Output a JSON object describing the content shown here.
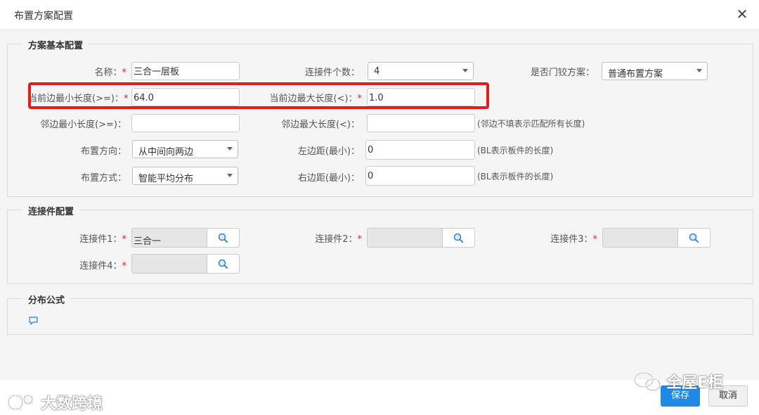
{
  "dialog": {
    "title": "布置方案配置",
    "close_glyph": "✕"
  },
  "basic": {
    "legend": "方案基本配置",
    "name": {
      "label": "名称：",
      "req": "*",
      "value": "三合一层板"
    },
    "connector_count": {
      "label": "连接件个数：",
      "value": "4"
    },
    "door_hinge": {
      "label": "是否门铰方案：",
      "value": "普通布置方案"
    },
    "cur_min": {
      "label": "当前边最小长度(>=)：",
      "req": "*",
      "value": "64.0"
    },
    "cur_max": {
      "label": "当前边最大长度(<)：",
      "req": "*",
      "value": "1.0"
    },
    "adj_min": {
      "label": "邻边最小长度(>=)：",
      "value": ""
    },
    "adj_max": {
      "label": "邻边最大长度(<)：",
      "value": "",
      "hint": "(邻边不填表示匹配所有长度)"
    },
    "direction": {
      "label": "布置方向：",
      "value": "从中间向两边"
    },
    "left_margin": {
      "label": "左边距(最小)：",
      "value": "0",
      "hint": "(BL表示板件的长度)"
    },
    "method": {
      "label": "布置方式：",
      "value": "智能平均分布"
    },
    "right_margin": {
      "label": "右边距(最小)：",
      "value": "0",
      "hint": "(BL表示板件的长度)"
    }
  },
  "connectors": {
    "legend": "连接件配置",
    "c1": {
      "label": "连接件1：",
      "req": "*",
      "value": "三合一"
    },
    "c2": {
      "label": "连接件2：",
      "req": "*",
      "value": ""
    },
    "c3": {
      "label": "连接件3：",
      "req": "*",
      "value": ""
    },
    "c4": {
      "label": "连接件4：",
      "req": "*",
      "value": ""
    }
  },
  "formula": {
    "legend": "分布公式"
  },
  "buttons": {
    "save": "保存",
    "cancel": "取消"
  },
  "watermarks": {
    "left": "大数跨境",
    "right": "全屋E柜"
  },
  "colors": {
    "primary": "#1e8ae6",
    "highlight": "#e51c1c",
    "required": "#e02020"
  },
  "icons": {
    "search": "search-icon",
    "comment": "comment-icon",
    "caret": "caret-down-icon"
  }
}
